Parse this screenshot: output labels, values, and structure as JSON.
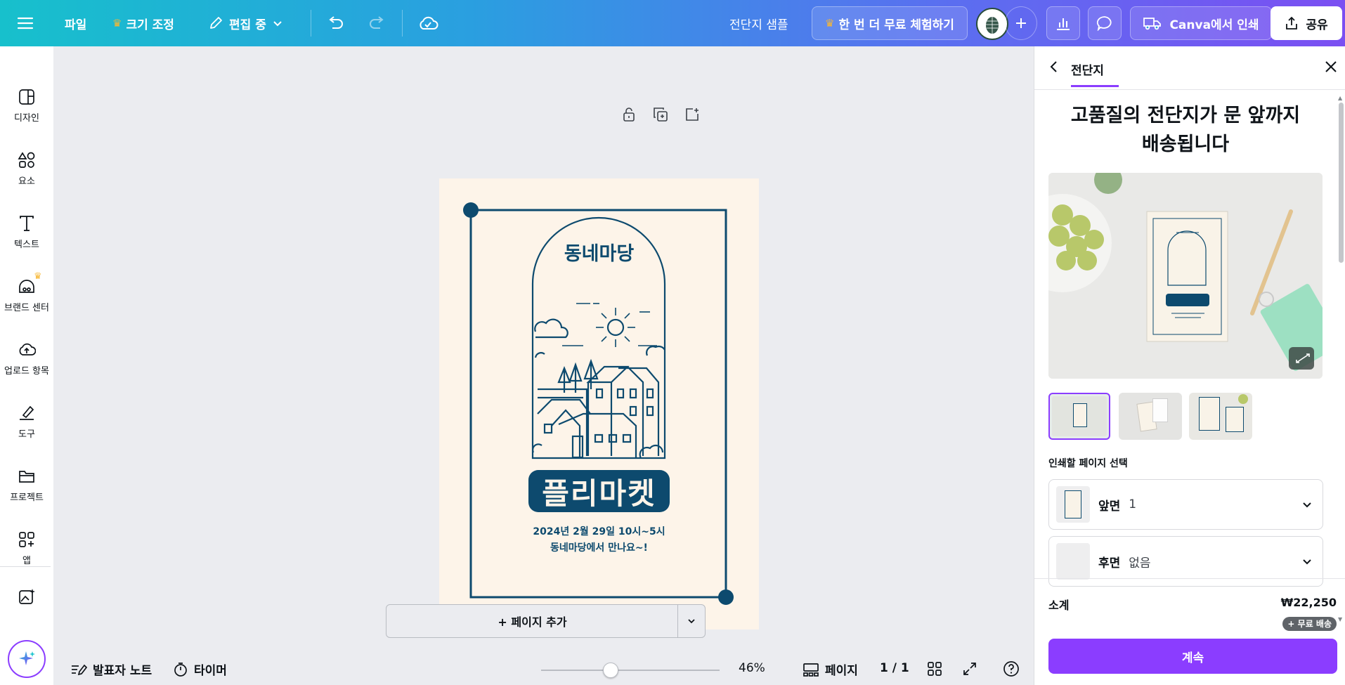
{
  "topbar": {
    "file": "파일",
    "resize": "크기 조정",
    "editing": "편집 중",
    "doc_title": "전단지 샘플",
    "trial": "한 번 더 무료 체험하기",
    "print": "Canva에서 인쇄",
    "share": "공유"
  },
  "rail": {
    "items": [
      {
        "label": "디자인",
        "icon": "design-icon"
      },
      {
        "label": "요소",
        "icon": "elements-icon"
      },
      {
        "label": "텍스트",
        "icon": "text-icon"
      },
      {
        "label": "브랜드 센터",
        "icon": "brand-icon"
      },
      {
        "label": "업로드 항목",
        "icon": "upload-icon"
      },
      {
        "label": "도구",
        "icon": "draw-icon"
      },
      {
        "label": "프로젝트",
        "icon": "folder-icon"
      },
      {
        "label": "앱",
        "icon": "apps-icon"
      }
    ]
  },
  "flyer": {
    "title": "동네마당",
    "headline": "플리마켓",
    "line1": "2024년 2월 29일 10시~5시",
    "line2": "동네마당에서 만나요~!",
    "colors": {
      "navy": "#0d4a6e",
      "cream": "#fdf4e9"
    }
  },
  "canvas": {
    "add_page": "+ 페이지 추가"
  },
  "bottombar": {
    "notes": "발표자 노트",
    "timer": "타이머",
    "zoom": "46%",
    "zoom_level": 0.46,
    "pages_label": "페이지",
    "page_count": "1 / 1"
  },
  "panel": {
    "tab": "전단지",
    "heading_line1": "고품질의 전단지가 문 앞까지",
    "heading_line2": "배송됩니다",
    "select_label": "인쇄할 페이지 선택",
    "front_label": "앞면",
    "front_value": "1",
    "back_label": "후면",
    "back_value": "없음",
    "subtotal_label": "소계",
    "subtotal_value": "₩22,250",
    "free_shipping": "+ 무료 배송",
    "continue": "계속"
  },
  "accent": "#8b3dff"
}
